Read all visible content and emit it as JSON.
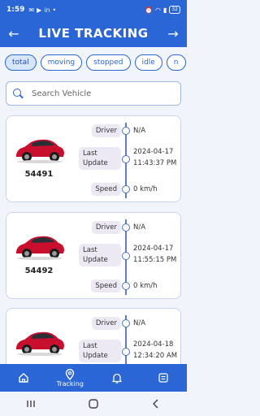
{
  "status_bar": {
    "time": "1:59",
    "battery": "32"
  },
  "header": {
    "title": "LIVE TRACKING",
    "back_icon": "arrow-left-icon",
    "forward_icon": "arrow-right-icon"
  },
  "filters": [
    {
      "label": "total",
      "active": true
    },
    {
      "label": "moving",
      "active": false
    },
    {
      "label": "stopped",
      "active": false
    },
    {
      "label": "idle",
      "active": false
    },
    {
      "label": "n",
      "active": false
    }
  ],
  "search": {
    "placeholder": "Search Vehicle",
    "value": ""
  },
  "vehicles": [
    {
      "number": "54491",
      "driver_label": "Driver",
      "driver": "N/A",
      "last_update_label": "Last Update",
      "last_update_date": "2024-04-17",
      "last_update_time": "11:43:37 PM",
      "speed_label": "Speed",
      "speed": "0 km/h"
    },
    {
      "number": "54492",
      "driver_label": "Driver",
      "driver": "N/A",
      "last_update_label": "Last Update",
      "last_update_date": "2024-04-17",
      "last_update_time": "11:55:15 PM",
      "speed_label": "Speed",
      "speed": "0 km/h"
    },
    {
      "number": "",
      "driver_label": "Driver",
      "driver": "N/A",
      "last_update_label": "Last Update",
      "last_update_date": "2024-04-18",
      "last_update_time": "12:34:20 AM",
      "speed_label": "Speed",
      "speed": ""
    }
  ],
  "bottom_nav": [
    {
      "label": "",
      "icon": "home-icon"
    },
    {
      "label": "Tracking",
      "icon": "location-pin-icon"
    },
    {
      "label": "",
      "icon": "bell-icon"
    },
    {
      "label": "",
      "icon": "list-icon"
    }
  ],
  "colors": {
    "primary": "#2a66d6",
    "background": "#f1f4fb",
    "car_red": "#c8102e"
  }
}
